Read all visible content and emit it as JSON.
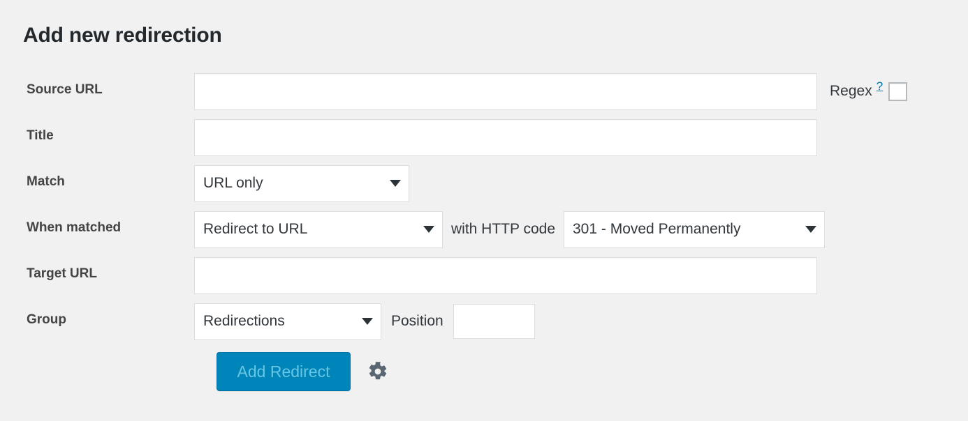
{
  "page": {
    "title": "Add new redirection"
  },
  "form": {
    "rows": {
      "source_url": {
        "label": "Source URL",
        "input_value": "",
        "input_placeholder": "",
        "regex_label": "Regex",
        "help_symbol": "?"
      },
      "title": {
        "label": "Title",
        "input_value": "",
        "input_placeholder": ""
      },
      "match": {
        "label": "Match",
        "selected": "URL only"
      },
      "when_matched": {
        "label": "When matched",
        "selected": "Redirect to URL",
        "between_text": "with HTTP code",
        "http_code_selected": "301 - Moved Permanently"
      },
      "target_url": {
        "label": "Target URL",
        "input_value": "",
        "input_placeholder": ""
      },
      "group": {
        "label": "Group",
        "selected": "Redirections",
        "position_label": "Position",
        "position_value": "",
        "position_placeholder": ""
      }
    },
    "submit": {
      "button_label": "Add Redirect",
      "gear_icon": "gear-icon"
    }
  },
  "colors": {
    "background": "#f1f1f1",
    "title": "#23282d",
    "label": "#444444",
    "field_border": "#dddddd",
    "primary_button": "#0085ba",
    "primary_button_text": "#66c6e4",
    "link": "#0073aa",
    "gear": "#5a6672",
    "checkbox_border": "#b4b9be"
  }
}
